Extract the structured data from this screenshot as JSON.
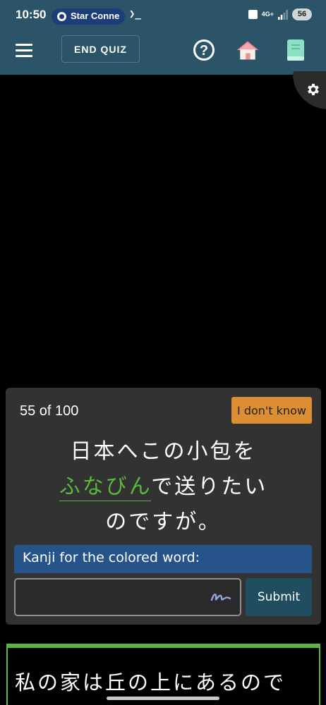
{
  "status_bar": {
    "time": "10:50",
    "notification": "Star Conne",
    "terminal": "❯_",
    "network": "4G+",
    "battery": "56"
  },
  "header": {
    "end_quiz_label": "END QUIZ",
    "icons": [
      "menu-icon",
      "help-icon",
      "home-icon",
      "book-icon"
    ]
  },
  "quiz": {
    "counter": "55 of 100",
    "dont_know_label": "I don't know",
    "sentence_line1": "日本へこの小包を",
    "sentence_highlight": "ふなびん",
    "sentence_line2_rest": "で送りたい",
    "sentence_line3": "のですが。",
    "prompt": "Kanji for the colored word:",
    "answer_value": "",
    "answer_placeholder": "",
    "submit_label": "Submit"
  },
  "next_card": {
    "text": "私の家は丘の上にあるので"
  },
  "colors": {
    "header_bg": "#2c5468",
    "card_bg": "#323232",
    "highlight": "#58b93b",
    "dont_know_bg": "#dc8f32",
    "prompt_bg": "#26548a",
    "submit_bg": "#214d61"
  }
}
